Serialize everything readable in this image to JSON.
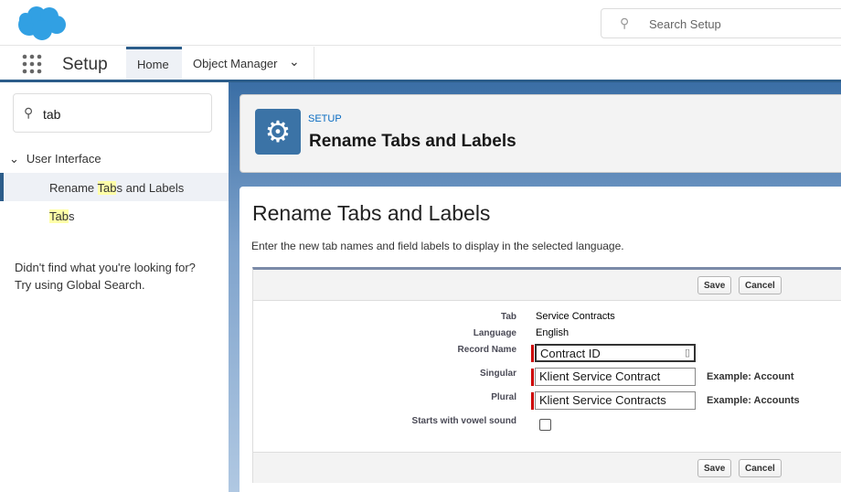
{
  "header": {
    "search_placeholder": "Search Setup",
    "app_title": "Setup",
    "tabs": [
      {
        "label": "Home"
      },
      {
        "label": "Object Manager"
      }
    ]
  },
  "sidebar": {
    "quickfind_value": "tab",
    "group": "User Interface",
    "items": [
      {
        "pre": "Rename ",
        "hl": "Tab",
        "post": "s and Labels"
      },
      {
        "pre": "",
        "hl": "Tab",
        "post": "s"
      }
    ],
    "help_line1": "Didn't find what you're looking for?",
    "help_line2": "Try using Global Search."
  },
  "page_header": {
    "eyebrow": "SETUP",
    "title": "Rename Tabs and Labels"
  },
  "main": {
    "title": "Rename Tabs and Labels",
    "description": "Enter the new tab names and field labels to display in the selected language.",
    "save_label": "Save",
    "cancel_label": "Cancel",
    "fields": {
      "tab_label": "Tab",
      "tab_value": "Service Contracts",
      "language_label": "Language",
      "language_value": "English",
      "record_name_label": "Record Name",
      "record_name_value": "Contract ID",
      "singular_label": "Singular",
      "singular_value": "Klient Service Contract",
      "singular_example": "Example: Account",
      "plural_label": "Plural",
      "plural_value": "Klient Service Contracts",
      "plural_example": "Example: Accounts",
      "vowel_label": "Starts with vowel sound",
      "vowel_checked": false
    }
  }
}
